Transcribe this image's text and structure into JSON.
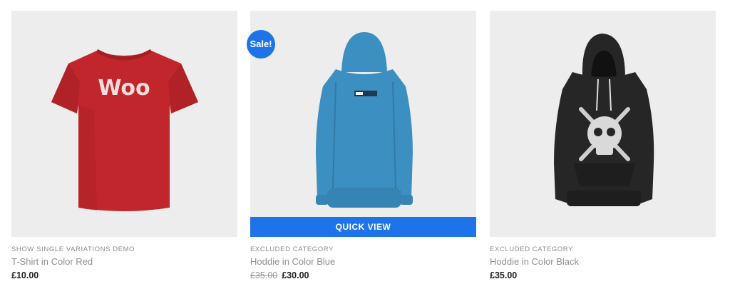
{
  "colors": {
    "accent": "#1e73e8",
    "thumb_bg": "#ededed",
    "tshirt_red": "#c0262b",
    "hoodie_blue": "#3c8fc1",
    "hoodie_black": "#262626"
  },
  "products": [
    {
      "category": "SHOW SINGLE VARIATIONS DEMO",
      "title": "T-Shirt in Color Red",
      "price": "£10.00",
      "image_text": "Woo",
      "image_icon": "red-tshirt-image"
    },
    {
      "category": "EXCLUDED CATEGORY",
      "title": "Hoddie in Color Blue",
      "old_price": "£35.00",
      "price": "£30.00",
      "badge": "Sale!",
      "quick_view": "QUICK VIEW",
      "image_icon": "blue-hoodie-image"
    },
    {
      "category": "EXCLUDED CATEGORY",
      "title": "Hoddie in Color Black",
      "price": "£35.00",
      "image_icon": "black-hoodie-image"
    }
  ]
}
